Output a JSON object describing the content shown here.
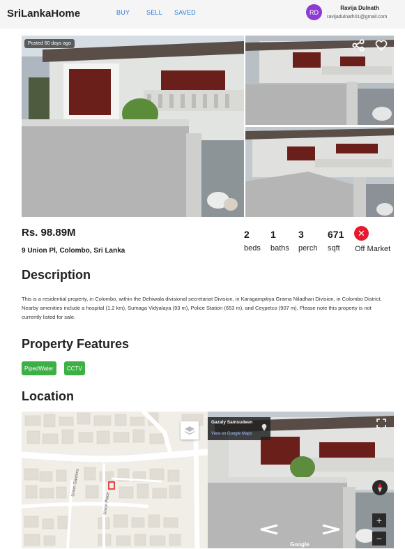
{
  "header": {
    "brand": "SriLankaHome",
    "nav": [
      {
        "label": "BUY"
      },
      {
        "label": "SELL"
      },
      {
        "label": "SAVED"
      }
    ],
    "user": {
      "initials": "RD",
      "name": "Ravija Dulnath",
      "email": "ravijadulnath01@gmail.com",
      "avatar_color": "#8e3bd6"
    }
  },
  "gallery": {
    "posted_badge": "Posted 60 days ago",
    "actions": [
      {
        "icon": "share-icon"
      },
      {
        "icon": "heart-icon"
      }
    ]
  },
  "listing": {
    "price": "Rs. 98.89M",
    "address": "9 Union Pl, Colombo, Sri Lanka",
    "stats": [
      {
        "value": "2",
        "label": "beds"
      },
      {
        "value": "1",
        "label": "baths"
      },
      {
        "value": "3",
        "label": "perch"
      },
      {
        "value": "671",
        "label": "sqft"
      }
    ],
    "status": {
      "icon": "close-icon",
      "label": "Off Market",
      "color": "#e8192c"
    }
  },
  "description": {
    "heading": "Description",
    "text": "This is a residential property, in Colombo, within the Dehiwala divisional secretariat Division, in Karagampitiya Grama Niladhari Division, in Colombo District, Nearby amenities include a hospital (1.2 km), Sumaga Vidyalaya (93 m), Police Station (653 m), and Ceypetco (907 m), Please note this property is not currently listed for sale."
  },
  "features": {
    "heading": "Property Features",
    "tags": [
      "PipedWater",
      "CCTV"
    ],
    "tag_color": "#3cb045"
  },
  "location": {
    "heading": "Location",
    "map": {
      "street_labels": [
        "Union Gardens",
        "Union Place"
      ],
      "layers_icon": "layers-icon"
    },
    "street_view": {
      "place_name": "Gazaly Samsudeen",
      "link": "View on Google Maps",
      "watermark": "Google",
      "zoom_in": "+",
      "zoom_out": "−"
    }
  }
}
